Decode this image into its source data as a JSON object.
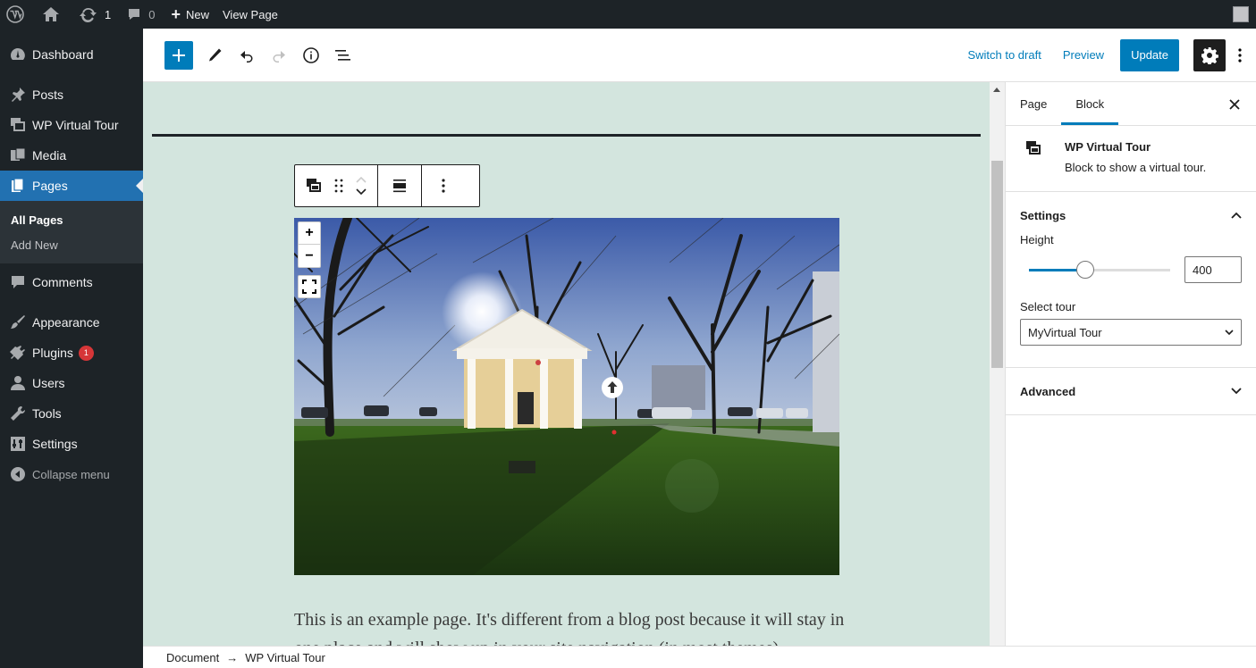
{
  "adminbar": {
    "updates_count": "1",
    "comments_count": "0",
    "new_label": "New",
    "view_page_label": "View Page"
  },
  "sidebar": {
    "items": [
      {
        "label": "Dashboard",
        "icon": "dashboard-icon"
      },
      {
        "label": "Posts",
        "icon": "pin-icon"
      },
      {
        "label": "WP Virtual Tour",
        "icon": "virtual-tour-icon"
      },
      {
        "label": "Media",
        "icon": "media-icon"
      },
      {
        "label": "Pages",
        "icon": "pages-icon"
      },
      {
        "label": "Comments",
        "icon": "comments-icon"
      },
      {
        "label": "Appearance",
        "icon": "appearance-icon"
      },
      {
        "label": "Plugins",
        "icon": "plugins-icon",
        "badge": "1"
      },
      {
        "label": "Users",
        "icon": "users-icon"
      },
      {
        "label": "Tools",
        "icon": "tools-icon"
      },
      {
        "label": "Settings",
        "icon": "settings-icon"
      }
    ],
    "submenu": [
      "All Pages",
      "Add New"
    ],
    "collapse_label": "Collapse menu"
  },
  "header": {
    "switch_to_draft": "Switch to draft",
    "preview": "Preview",
    "update": "Update"
  },
  "canvas": {
    "paragraph": "This is an example page. It's different from a blog post because it will stay in one place and will show up in your site navigation (in most themes)."
  },
  "panel": {
    "tabs": [
      "Page",
      "Block"
    ],
    "block_title": "WP Virtual Tour",
    "block_desc": "Block to show a virtual tour.",
    "settings_title": "Settings",
    "height_label": "Height",
    "height_value": "400",
    "height_fraction": 0.4,
    "select_label": "Select tour",
    "select_value": "MyVirtual Tour",
    "advanced_title": "Advanced"
  },
  "footer": {
    "breadcrumb": [
      "Document",
      "WP Virtual Tour"
    ],
    "separator": "→"
  },
  "colors": {
    "accent": "#007cba",
    "admin_dark": "#1d2327",
    "canvas_bg": "#d3e5de"
  }
}
